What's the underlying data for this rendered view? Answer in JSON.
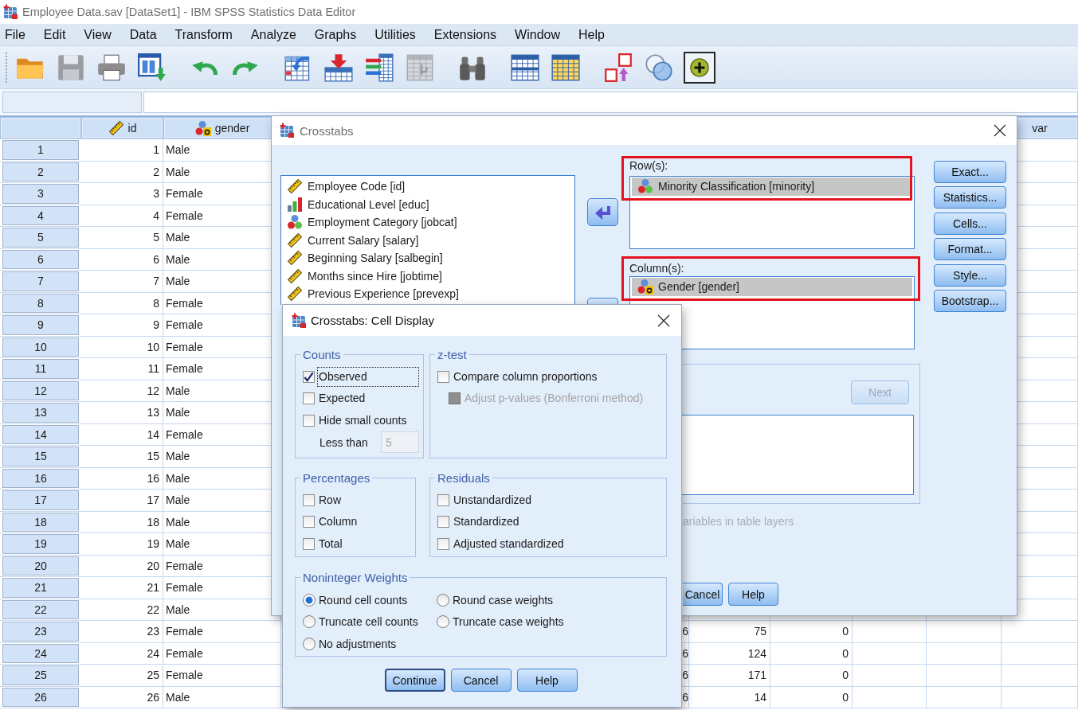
{
  "window": {
    "title": "Employee Data.sav [DataSet1] - IBM SPSS Statistics Data Editor"
  },
  "menu": [
    "File",
    "Edit",
    "View",
    "Data",
    "Transform",
    "Analyze",
    "Graphs",
    "Utilities",
    "Extensions",
    "Window",
    "Help"
  ],
  "toolbar": [
    [
      {
        "kind": "folder",
        "disabled": false,
        "pressed": false
      },
      {
        "kind": "floppy",
        "disabled": true,
        "pressed": false
      },
      {
        "kind": "printer",
        "disabled": false,
        "pressed": false
      },
      {
        "kind": "window_arrow",
        "disabled": false,
        "pressed": false
      }
    ],
    [
      {
        "kind": "undo",
        "disabled": false,
        "pressed": false
      },
      {
        "kind": "redo",
        "disabled": false,
        "pressed": false
      }
    ],
    [
      {
        "kind": "table_arrow",
        "disabled": false,
        "pressed": false
      },
      {
        "kind": "table_down_arrow",
        "disabled": false,
        "pressed": false
      },
      {
        "kind": "list_table",
        "disabled": false,
        "pressed": false
      },
      {
        "kind": "grid",
        "disabled": true,
        "pressed": false
      }
    ],
    [
      {
        "kind": "binoculars",
        "disabled": false,
        "pressed": false
      }
    ],
    [
      {
        "kind": "table",
        "disabled": false,
        "pressed": false
      },
      {
        "kind": "table_header",
        "disabled": false,
        "pressed": false
      }
    ],
    [
      {
        "kind": "label_swap",
        "disabled": false,
        "pressed": false
      },
      {
        "kind": "circles",
        "disabled": false,
        "pressed": false
      },
      {
        "kind": "plus_circle",
        "disabled": false,
        "pressed": true
      }
    ]
  ],
  "grid": {
    "columns": [
      {
        "label": "id",
        "kind": "scale"
      },
      {
        "label": "gender",
        "kind": "nominal_string"
      }
    ],
    "far_column": {
      "label": "var"
    },
    "rows": [
      {
        "case": "1",
        "cells": [
          "1",
          "Male"
        ]
      },
      {
        "case": "2",
        "cells": [
          "2",
          "Male"
        ]
      },
      {
        "case": "3",
        "cells": [
          "3",
          "Female"
        ]
      },
      {
        "case": "4",
        "cells": [
          "4",
          "Female"
        ]
      },
      {
        "case": "5",
        "cells": [
          "5",
          "Male"
        ]
      },
      {
        "case": "6",
        "cells": [
          "6",
          "Male"
        ]
      },
      {
        "case": "7",
        "cells": [
          "7",
          "Male"
        ]
      },
      {
        "case": "8",
        "cells": [
          "8",
          "Female"
        ]
      },
      {
        "case": "9",
        "cells": [
          "9",
          "Female"
        ]
      },
      {
        "case": "10",
        "cells": [
          "10",
          "Female"
        ]
      },
      {
        "case": "11",
        "cells": [
          "11",
          "Female"
        ]
      },
      {
        "case": "12",
        "cells": [
          "12",
          "Male"
        ]
      },
      {
        "case": "13",
        "cells": [
          "13",
          "Male"
        ]
      },
      {
        "case": "14",
        "cells": [
          "14",
          "Female"
        ]
      },
      {
        "case": "15",
        "cells": [
          "15",
          "Male"
        ]
      },
      {
        "case": "16",
        "cells": [
          "16",
          "Male"
        ]
      },
      {
        "case": "17",
        "cells": [
          "17",
          "Male"
        ]
      },
      {
        "case": "18",
        "cells": [
          "18",
          "Male"
        ]
      },
      {
        "case": "19",
        "cells": [
          "19",
          "Male"
        ]
      },
      {
        "case": "20",
        "cells": [
          "20",
          "Female"
        ]
      },
      {
        "case": "21",
        "cells": [
          "21",
          "Female"
        ]
      },
      {
        "case": "22",
        "cells": [
          "22",
          "Male"
        ]
      },
      {
        "case": "23",
        "cells": [
          "23",
          "Female"
        ],
        "right_cells": [
          "6",
          "75",
          "0"
        ]
      },
      {
        "case": "24",
        "cells": [
          "24",
          "Female"
        ],
        "right_cells": [
          "6",
          "124",
          "0"
        ]
      },
      {
        "case": "25",
        "cells": [
          "25",
          "Female"
        ],
        "right_cells": [
          "6",
          "171",
          "0"
        ]
      },
      {
        "case": "26",
        "cells": [
          "26",
          "Male"
        ],
        "right_cells": [
          "6",
          "14",
          "0"
        ]
      }
    ]
  },
  "crosstabs": {
    "title": "Crosstabs",
    "active": false,
    "variables": [
      {
        "label": "Employee Code [id]",
        "kind": "scale",
        "selected": false
      },
      {
        "label": "Educational Level [educ]",
        "kind": "ordinal",
        "selected": false
      },
      {
        "label": "Employment Category [jobcat]",
        "kind": "nominal",
        "selected": false
      },
      {
        "label": "Current Salary [salary]",
        "kind": "scale",
        "selected": false
      },
      {
        "label": "Beginning Salary [salbegin]",
        "kind": "scale",
        "selected": false
      },
      {
        "label": "Months since Hire [jobtime]",
        "kind": "scale",
        "selected": false
      },
      {
        "label": "Previous Experience [prevexp]",
        "kind": "scale",
        "selected": false
      }
    ],
    "rows_box": {
      "label": "Row(s):",
      "highlighted": true,
      "items": [
        {
          "label": "Minority Classification [minority]",
          "kind": "nominal",
          "selected": true
        }
      ]
    },
    "columns_box": {
      "label": "Column(s):",
      "highlighted": true,
      "items": [
        {
          "label": "Gender [gender]",
          "kind": "nominal_string",
          "selected": true
        }
      ]
    },
    "side_buttons": [
      "Exact...",
      "Statistics...",
      "Cells...",
      "Format...",
      "Style...",
      "Bootstrap..."
    ],
    "layers": {
      "next": {
        "label": "Next",
        "disabled": true
      },
      "note": {
        "label": "ariables in table layers",
        "disabled": true
      }
    },
    "footer_buttons": [
      "Cancel",
      "Help"
    ]
  },
  "cell_display": {
    "title": "Crosstabs: Cell Display",
    "active": true,
    "groups": [
      {
        "title": "Counts",
        "items": [
          {
            "kind": "checkbox",
            "label": "Observed",
            "checked": true,
            "disabled": false,
            "focused": true
          },
          {
            "kind": "checkbox",
            "label": "Expected",
            "checked": false,
            "disabled": false,
            "focused": false
          },
          {
            "kind": "checkbox",
            "label": "Hide small counts",
            "checked": false,
            "disabled": false,
            "focused": false
          },
          {
            "kind": "number_field",
            "label": "Less than",
            "value": "5",
            "disabled": true
          }
        ]
      },
      {
        "title": "z-test",
        "items": [
          {
            "kind": "checkbox",
            "label": "Compare column proportions",
            "checked": false,
            "disabled": false,
            "focused": false
          },
          {
            "kind": "sub_checkbox",
            "label": "Adjust p-values (Bonferroni method)",
            "checked": false,
            "disabled": true,
            "focused": false
          }
        ]
      },
      {
        "title": "Percentages",
        "items": [
          {
            "kind": "checkbox",
            "label": "Row",
            "checked": false,
            "disabled": false,
            "focused": false
          },
          {
            "kind": "checkbox",
            "label": "Column",
            "checked": false,
            "disabled": false,
            "focused": false
          },
          {
            "kind": "checkbox",
            "label": "Total",
            "checked": false,
            "disabled": false,
            "focused": false
          }
        ]
      },
      {
        "title": "Residuals",
        "items": [
          {
            "kind": "checkbox",
            "label": "Unstandardized",
            "checked": false,
            "disabled": false,
            "focused": false
          },
          {
            "kind": "checkbox",
            "label": "Standardized",
            "checked": false,
            "disabled": false,
            "focused": false
          },
          {
            "kind": "checkbox",
            "label": "Adjusted standardized",
            "checked": false,
            "disabled": false,
            "focused": false
          }
        ]
      }
    ],
    "weights": {
      "title": "Noninteger Weights",
      "options": [
        {
          "label": "Round cell counts",
          "selected": true
        },
        {
          "label": "Round case weights",
          "selected": false
        },
        {
          "label": "Truncate cell counts",
          "selected": false
        },
        {
          "label": "Truncate case weights",
          "selected": false
        },
        {
          "label": "No adjustments",
          "selected": false
        }
      ]
    },
    "buttons": [
      {
        "label": "Continue",
        "default": true
      },
      {
        "label": "Cancel",
        "default": false
      },
      {
        "label": "Help",
        "default": false
      }
    ]
  }
}
